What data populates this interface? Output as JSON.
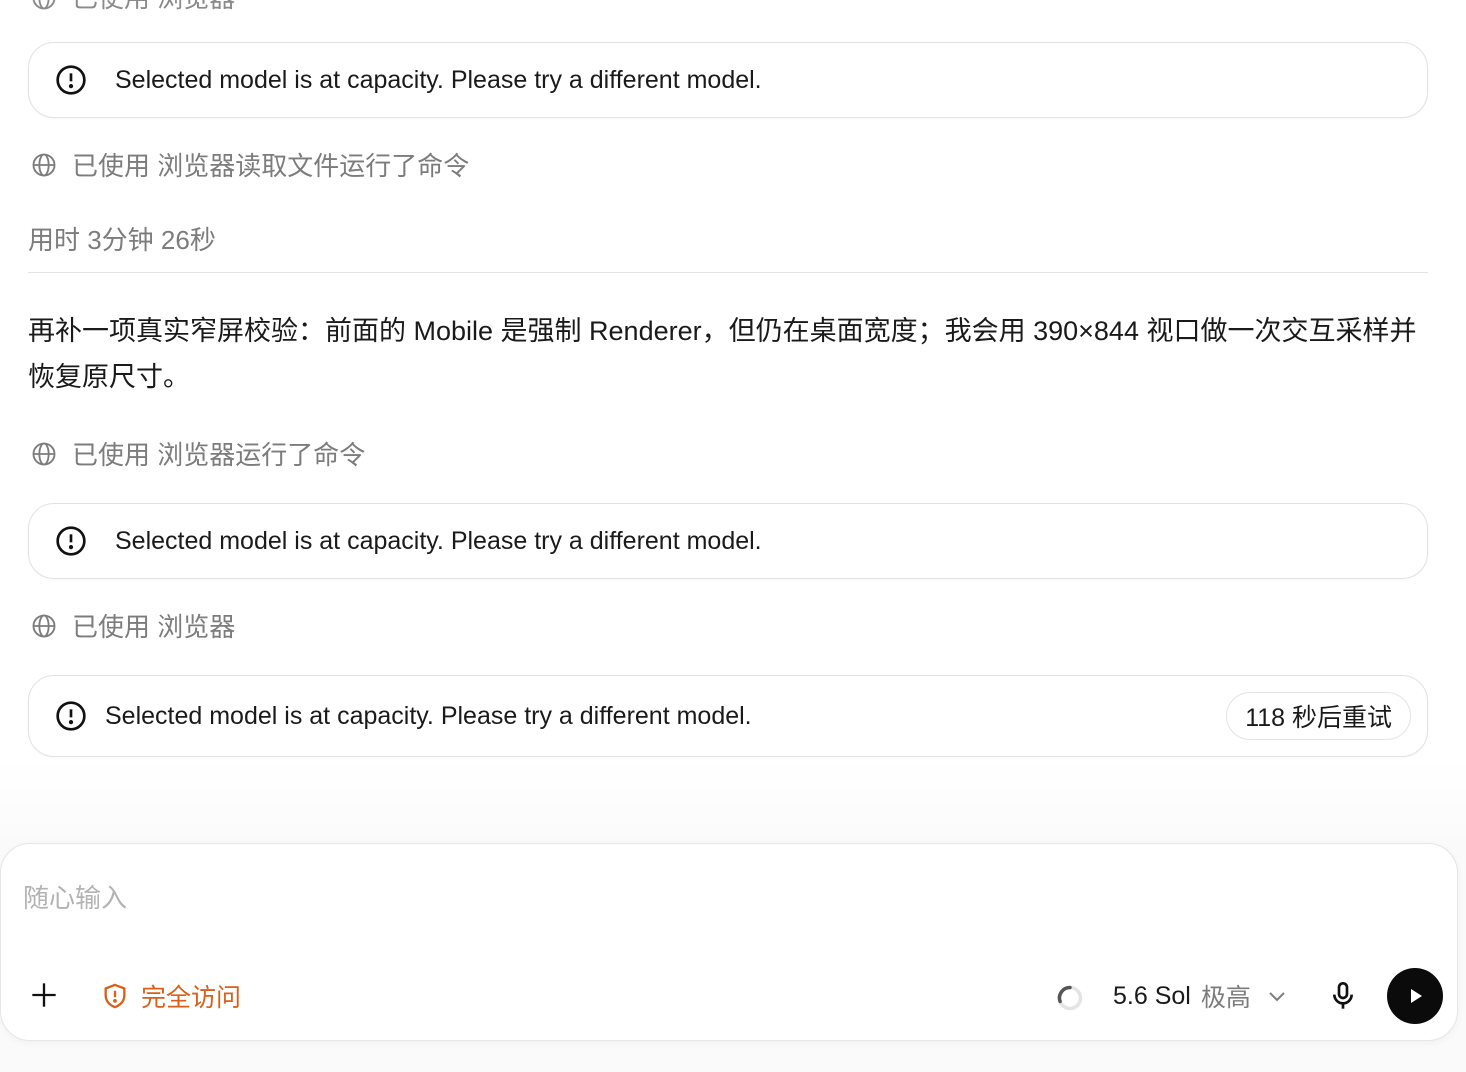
{
  "top_partial_row": {
    "label": "已使用 浏览器"
  },
  "errors": [
    {
      "message": "Selected model is at capacity. Please try a different model."
    },
    {
      "message": "Selected model is at capacity. Please try a different model."
    },
    {
      "message": "Selected model is at capacity. Please try a different model.",
      "retry": "118 秒后重试"
    }
  ],
  "tool_rows": [
    {
      "label": "已使用 浏览器读取文件运行了命令"
    },
    {
      "label": "已使用 浏览器运行了命令"
    },
    {
      "label": "已使用 浏览器"
    }
  ],
  "elapsed": "用时 3分钟 26秒",
  "assistant_message": "再补一项真实窄屏校验：前面的 Mobile 是强制 Renderer，但仍在桌面宽度；我会用 390×844 视口做一次交互采样并恢复原尺寸。",
  "composer": {
    "placeholder": "随心输入",
    "access_label": "完全访问",
    "model_name": "5.6 Sol",
    "effort_label": "极高"
  },
  "colors": {
    "access_orange": "#d9601a",
    "muted_text": "#7c7c7c",
    "send_button": "#0b0b0b"
  },
  "icons": [
    "alert-circle-icon",
    "globe-icon",
    "plus-icon",
    "shield-alert-icon",
    "spinner-icon",
    "chevron-down-icon",
    "microphone-icon",
    "play-icon"
  ]
}
